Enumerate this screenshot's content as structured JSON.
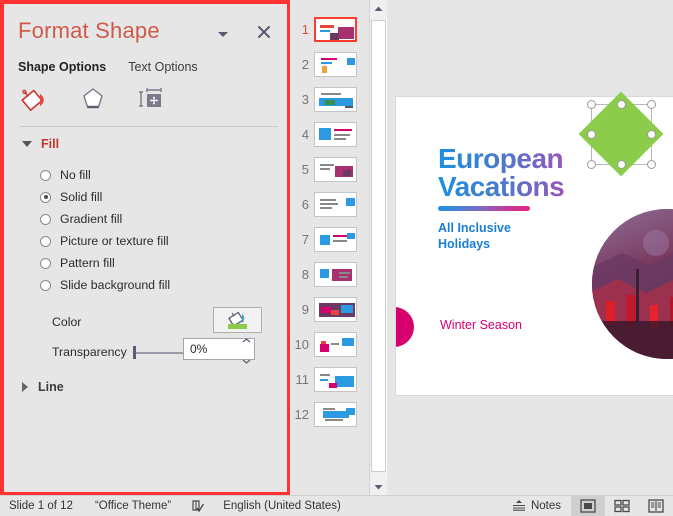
{
  "format_pane": {
    "title": "Format Shape",
    "dropdown_icon": "chevron-down-icon",
    "close_icon": "close-icon",
    "tabs": [
      {
        "label": "Shape Options",
        "active": true
      },
      {
        "label": "Text Options",
        "active": false
      }
    ],
    "category_icons": [
      {
        "name": "fill-line-icon",
        "title": "Fill & Line"
      },
      {
        "name": "effects-icon",
        "title": "Effects"
      },
      {
        "name": "size-properties-icon",
        "title": "Size & Properties"
      }
    ],
    "fill_section": {
      "label": "Fill",
      "expanded": true,
      "options": [
        {
          "label": "No fill",
          "accel": "N",
          "selected": false
        },
        {
          "label": "Solid fill",
          "accel": "S",
          "selected": true
        },
        {
          "label": "Gradient fill",
          "accel": "G",
          "selected": false
        },
        {
          "label": "Picture or texture fill",
          "accel": "P",
          "selected": false
        },
        {
          "label": "Pattern fill",
          "accel": "a",
          "selected": false
        },
        {
          "label": "Slide background fill",
          "accel": "b",
          "selected": false
        }
      ],
      "color": {
        "label": "Color",
        "accel": "C",
        "button_icon": "paint-bucket-icon",
        "swatch_hex": "#8ccc4b",
        "arrow_icon": "chevron-down-icon"
      },
      "transparency": {
        "label": "Transparency",
        "accel": "T",
        "value": "0%",
        "slider_percent": 0
      }
    },
    "line_section": {
      "label": "Line",
      "expanded": false
    },
    "highlight_hex": "#ff3333"
  },
  "thumbnails": {
    "slides": [
      {
        "number": "1",
        "selected": true
      },
      {
        "number": "2",
        "selected": false
      },
      {
        "number": "3",
        "selected": false
      },
      {
        "number": "4",
        "selected": false
      },
      {
        "number": "5",
        "selected": false
      },
      {
        "number": "6",
        "selected": false
      },
      {
        "number": "7",
        "selected": false
      },
      {
        "number": "8",
        "selected": false
      },
      {
        "number": "9",
        "selected": false
      },
      {
        "number": "10",
        "selected": false
      },
      {
        "number": "11",
        "selected": false
      },
      {
        "number": "12",
        "selected": false
      }
    ],
    "scrollbar": {
      "up_icon": "scroll-up-icon",
      "down_icon": "scroll-down-icon"
    }
  },
  "slide": {
    "title_line1": "European",
    "title_line2": "Vacations",
    "subtitle": "All Inclusive\nHolidays",
    "caption": "Winter Season",
    "title_gradient_start": "#1f8fe0",
    "title_gradient_end": "#e0267f",
    "caption_color": "#d6006e",
    "subtitle_color": "#1a7fd4",
    "selected_shape": {
      "name": "green-diamond",
      "fill_hex": "#8ccc4b",
      "rotate_icon": "rotate-handle-icon"
    }
  },
  "status_bar": {
    "slide_count": "Slide 1 of 12",
    "theme": "“Office Theme”",
    "spellcheck_icon": "spellcheck-icon",
    "language": "English (United States)",
    "notes_label": "Notes",
    "notes_icon": "notes-icon",
    "views": [
      {
        "name": "normal-view",
        "icon": "normal-view-icon",
        "active": true
      },
      {
        "name": "slide-sorter-view",
        "icon": "slide-sorter-icon",
        "active": false
      },
      {
        "name": "reading-view",
        "icon": "reading-view-icon",
        "active": false
      }
    ]
  }
}
